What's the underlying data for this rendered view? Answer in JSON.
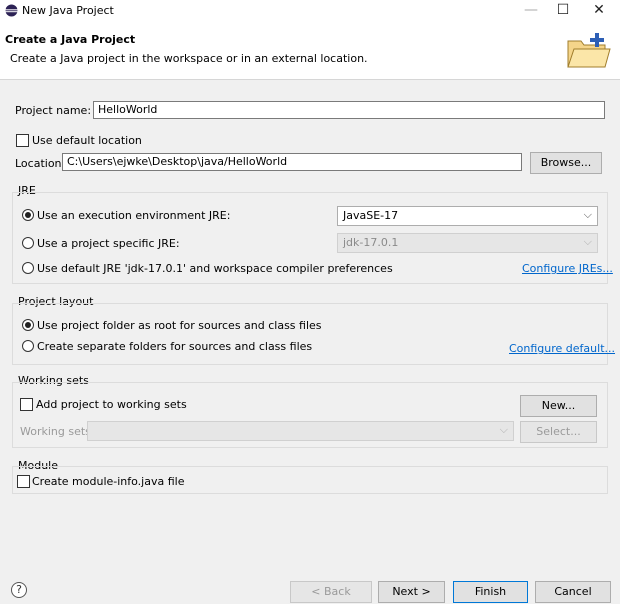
{
  "window": {
    "title": "New Java Project",
    "controls": {
      "minimize": "—",
      "maximize": "☐",
      "close": "✕"
    }
  },
  "header": {
    "title": "Create a Java Project",
    "description": "Create a Java project in the workspace or in an external location."
  },
  "project": {
    "name_label": "Project name:",
    "name_value": "HelloWorld",
    "use_default_location_label": "Use default location",
    "use_default_location_checked": false,
    "location_label": "Location:",
    "location_value": "C:\\Users\\ejwke\\Desktop\\java/HelloWorld",
    "browse_label": "Browse..."
  },
  "jre": {
    "group_title": "JRE",
    "option_env_label": "Use an execution environment JRE:",
    "option_env_selected": true,
    "env_value": "JavaSE-17",
    "option_specific_label": "Use a project specific JRE:",
    "specific_value": "jdk-17.0.1",
    "option_default_label": "Use default JRE 'jdk-17.0.1' and workspace compiler preferences",
    "configure_link": "Configure JREs..."
  },
  "layout": {
    "group_title": "Project layout",
    "option_root_label": "Use project folder as root for sources and class files",
    "option_root_selected": true,
    "option_separate_label": "Create separate folders for sources and class files",
    "configure_link": "Configure default..."
  },
  "working_sets": {
    "group_title": "Working sets",
    "add_label": "Add project to working sets",
    "add_checked": false,
    "new_label": "New...",
    "sets_label": "Working sets:",
    "select_label": "Select..."
  },
  "module": {
    "group_title": "Module",
    "create_label": "Create module-info.java file",
    "create_checked": false
  },
  "footer": {
    "help_glyph": "?",
    "back_label": "< Back",
    "next_label": "Next >",
    "finish_label": "Finish",
    "cancel_label": "Cancel"
  }
}
